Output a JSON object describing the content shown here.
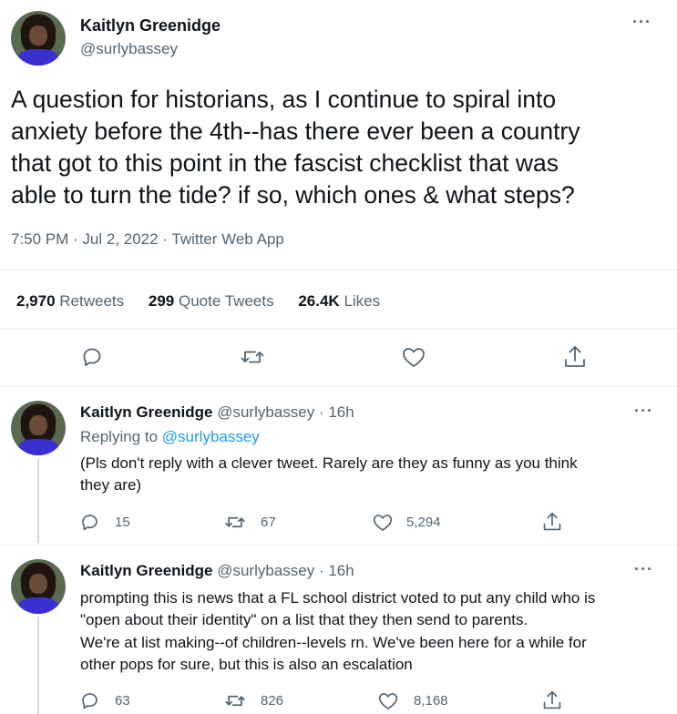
{
  "main_tweet": {
    "author_name": "Kaitlyn Greenidge",
    "author_handle": "@surlybassey",
    "text_lines": [
      "A question for historians, as I continue to spiral into",
      "anxiety before the 4th--has there ever been a country",
      "that got to this point in the fascist checklist that was",
      "able to turn the tide? if so, which ones & what steps?"
    ],
    "meta": "7:50 PM · Jul 2, 2022 · Twitter Web App",
    "stats": {
      "retweets_count": "2,970",
      "retweets_label": "Retweets",
      "quotes_count": "299",
      "quotes_label": "Quote Tweets",
      "likes_count": "26.4K",
      "likes_label": "Likes"
    },
    "more": "···"
  },
  "replies": [
    {
      "author_name": "Kaitlyn Greenidge",
      "author_handle": "@surlybassey",
      "time": "· 16h",
      "replying_prefix": "Replying to",
      "replying_to": "@surlybassey",
      "text_lines": [
        "(Pls don't reply with a clever tweet. Rarely are they as funny as you think",
        "they are)"
      ],
      "reply_count": "15",
      "retweet_count": "67",
      "like_count": "5,294",
      "more": "···"
    },
    {
      "author_name": "Kaitlyn Greenidge",
      "author_handle": "@surlybassey",
      "time": "· 16h",
      "text_lines": [
        "prompting this is news that a FL school district voted to put any child who is",
        "\"open about their identity\" on a list that they then send to parents.",
        "We're at list making--of children--levels rn. We've been here for a while for",
        "other pops for sure, but this is also an escalation"
      ],
      "reply_count": "63",
      "retweet_count": "826",
      "like_count": "8,168",
      "more": "···"
    }
  ],
  "icons": {
    "reply": "reply-icon",
    "retweet": "retweet-icon",
    "like": "heart-icon",
    "share": "share-icon",
    "more": "more-icon"
  },
  "colors": {
    "text": "#0f1419",
    "muted": "#536471",
    "link": "#1d9bf0",
    "divider": "#eff3f4"
  }
}
